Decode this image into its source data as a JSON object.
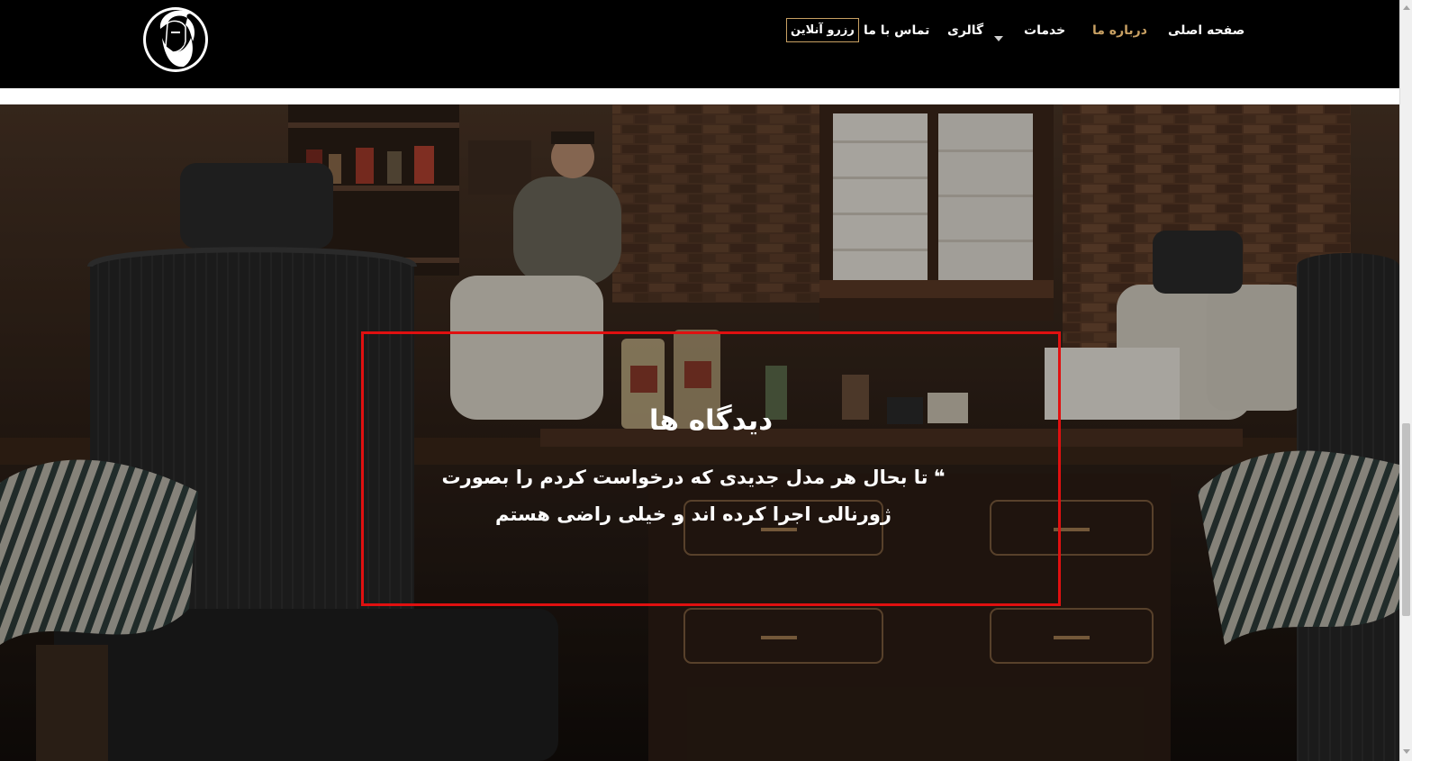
{
  "nav": {
    "items": [
      {
        "label": "صفحه اصلی",
        "active": false
      },
      {
        "label": "درباره ما",
        "active": true
      },
      {
        "label": "خدمات",
        "active": false
      },
      {
        "label": "گالری",
        "active": false,
        "has_dropdown": true
      },
      {
        "label": "تماس با ما",
        "active": false
      }
    ],
    "reserve_label": "رزرو آنلاین"
  },
  "logo": {
    "icon": "bearded-man-logo-icon"
  },
  "hero": {
    "title": "دیدگاه ها",
    "quote_icon": "quote-icon",
    "quote_glyph": "❝",
    "quote_line1": "تا بحال هر مدل جدیدی که درخواست کردم را بصورت",
    "quote_line2": "ژورنالی اجرا کرده اند و خیلی راضی هستم",
    "background": "barbershop-interior-photo"
  },
  "colors": {
    "accent": "#c8a063",
    "header_bg": "#000000",
    "highlight": "#e01010"
  }
}
